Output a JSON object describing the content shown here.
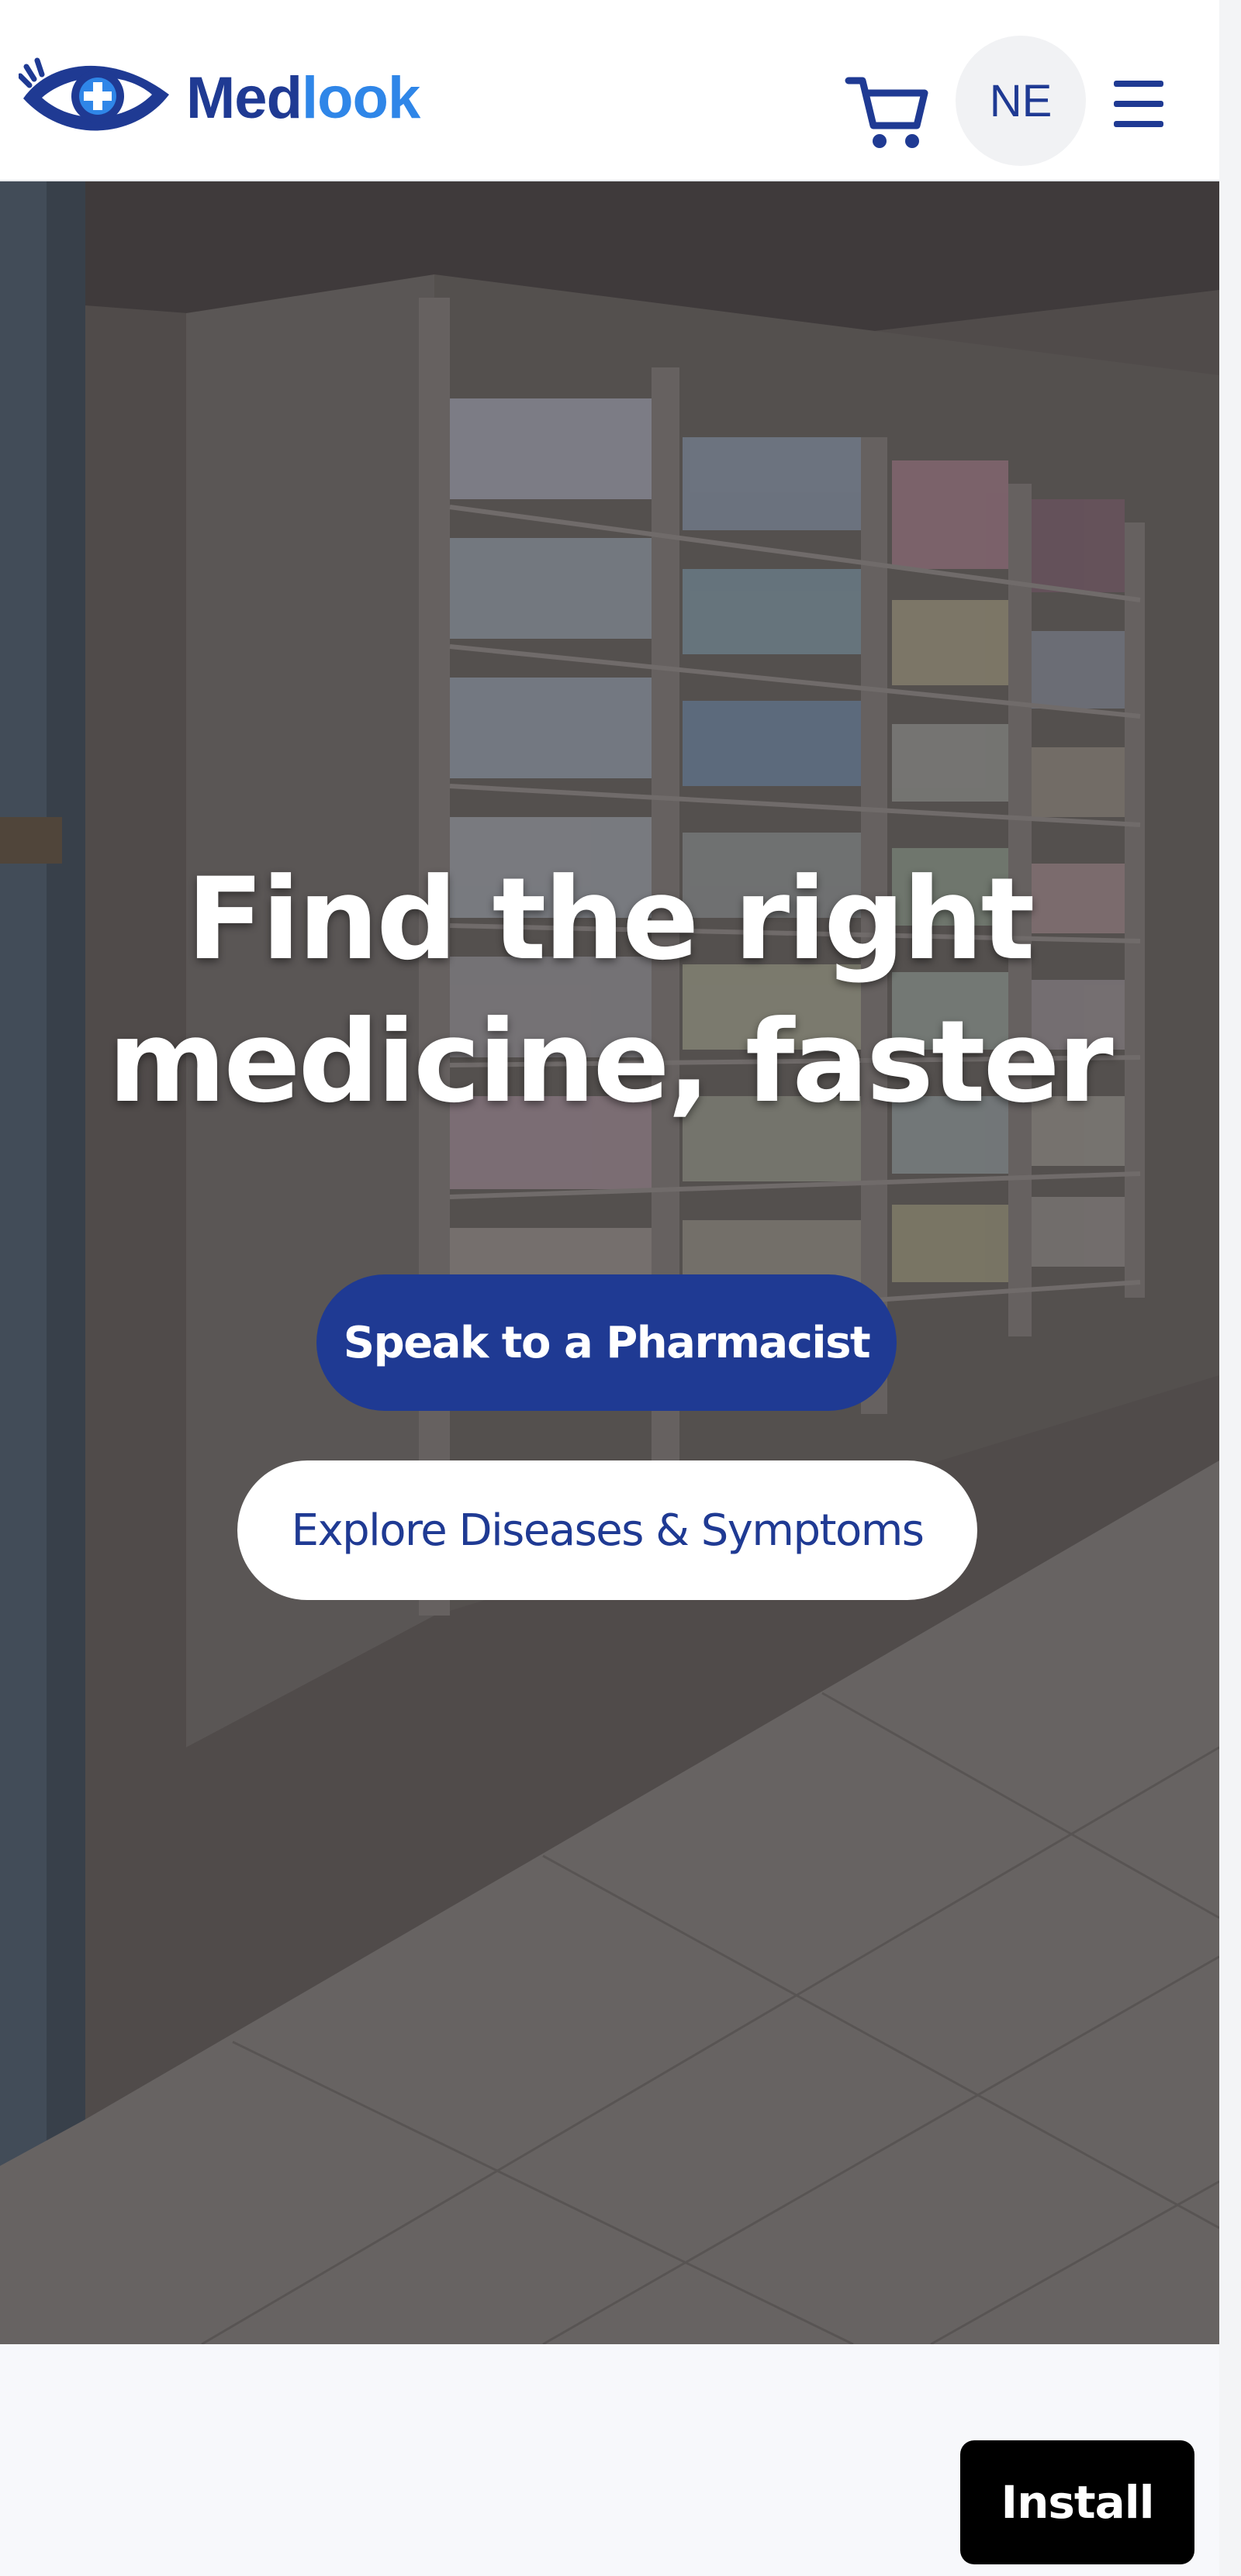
{
  "header": {
    "logo": {
      "name_part1": "Med",
      "name_part2": "look",
      "icon": "eye-cross-logo-icon"
    },
    "cart_icon": "cart-icon",
    "avatar_initials": "NE",
    "menu_icon": "hamburger-menu-icon"
  },
  "hero": {
    "title_line1": "Find the right",
    "title_line2": "medicine, faster",
    "primary_cta": "Speak to a Pharmacist",
    "secondary_cta": "Explore Diseases & Symptoms",
    "background": "pharmacy-shelves-photo"
  },
  "install": {
    "label": "Install"
  },
  "colors": {
    "brand_dark": "#1f3a93",
    "brand_light": "#2f86e8",
    "primary_button": "#1f3a93",
    "install_button": "#000000"
  }
}
